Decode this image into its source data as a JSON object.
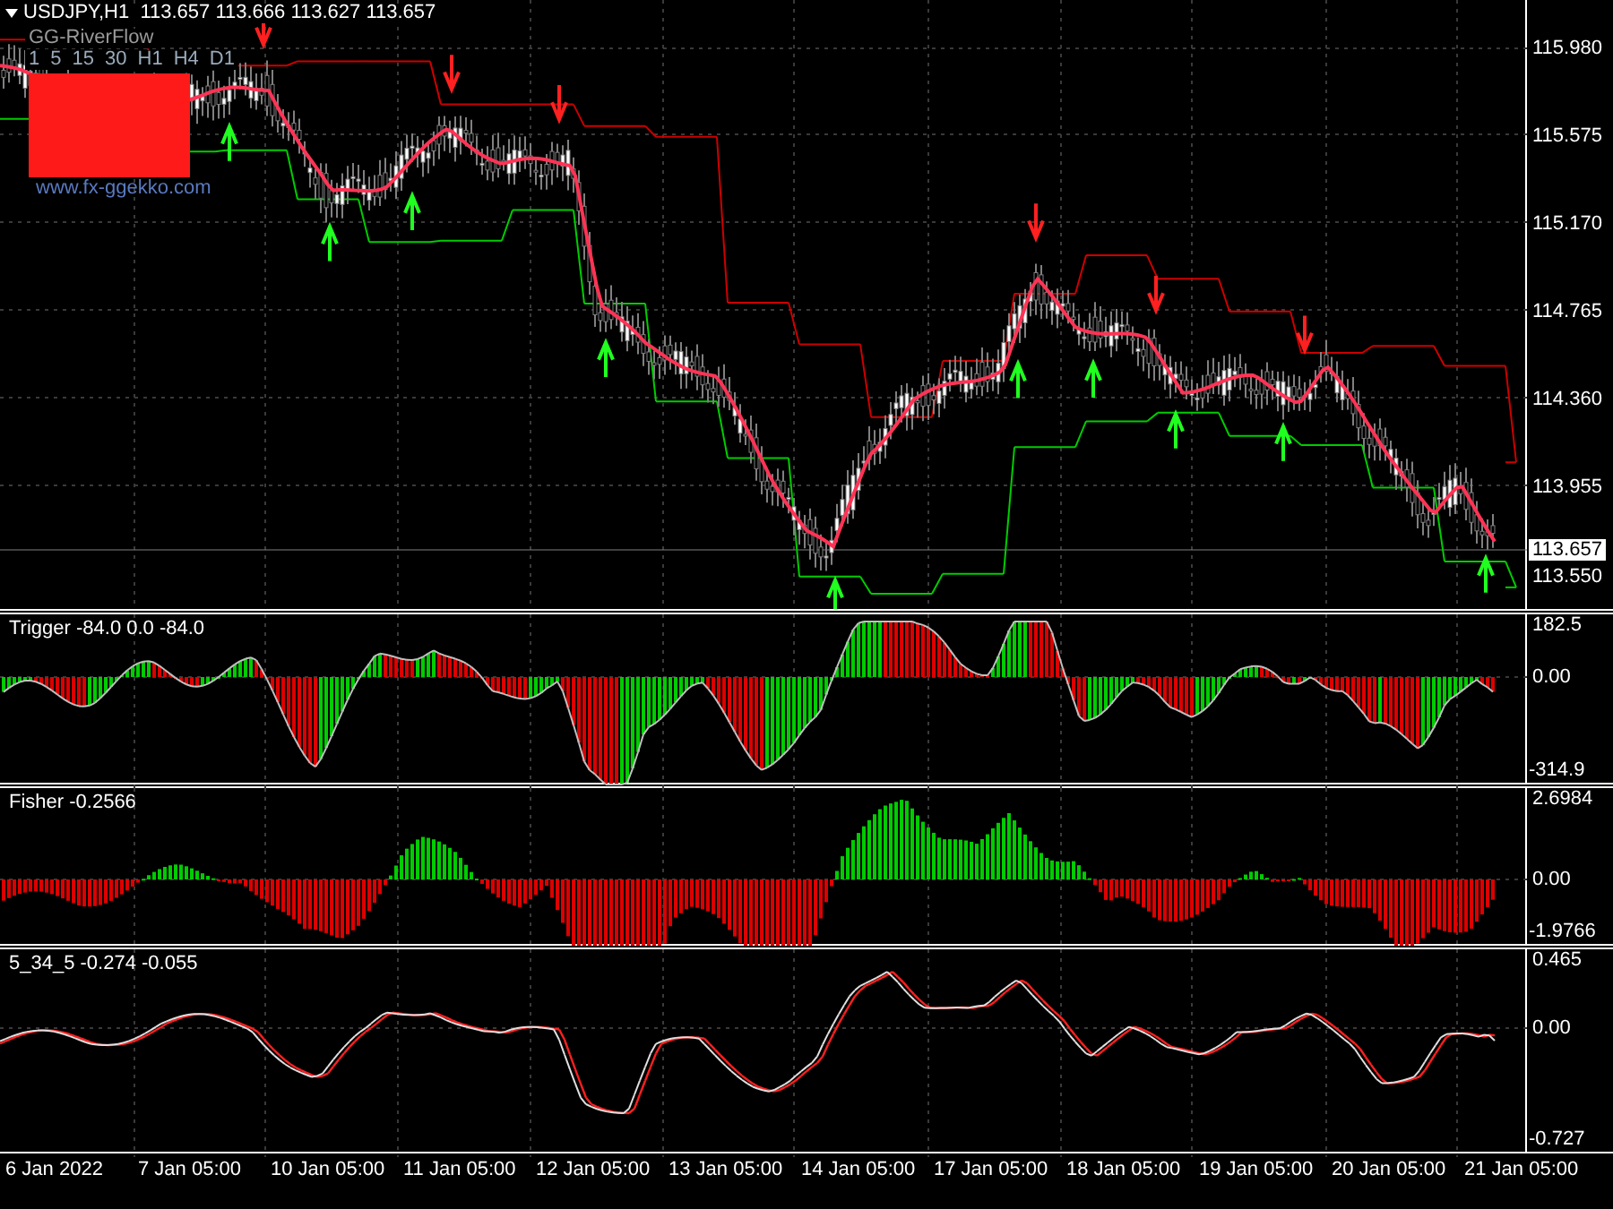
{
  "main": {
    "symbol_header": "USDJPY,H1  113.657 113.666 113.627 113.657",
    "indicator_panel": {
      "title": "GG-RiverFlow",
      "timeframes": [
        "1",
        "5",
        "15",
        "30",
        "H1",
        "H4",
        "D1"
      ],
      "website": "www.fx-ggekko.com"
    },
    "price_labels": [
      "115.980",
      "115.575",
      "115.170",
      "114.765",
      "114.360",
      "113.955",
      "113.550"
    ],
    "current_price": "113.657"
  },
  "subwindows": [
    {
      "kind": "trigger",
      "title": "Trigger -84.0 0.0 -84.0",
      "axis_labels": [
        "182.5",
        "0.00",
        "-314.9"
      ]
    },
    {
      "kind": "fisher",
      "title": "Fisher -0.2566",
      "axis_labels": [
        "2.6984",
        "0.00",
        "-1.9766"
      ]
    },
    {
      "kind": "oscillator",
      "title": "5_34_5 -0.274 -0.055",
      "axis_labels": [
        "0.465",
        "0.00",
        "-0.727"
      ]
    }
  ],
  "time_labels": [
    "6 Jan 2022",
    "7 Jan 05:00",
    "10 Jan 05:00",
    "11 Jan 05:00",
    "12 Jan 05:00",
    "13 Jan 05:00",
    "14 Jan 05:00",
    "17 Jan 05:00",
    "18 Jan 05:00",
    "19 Jan 05:00",
    "20 Jan 05:00",
    "21 Jan 05:00"
  ]
}
